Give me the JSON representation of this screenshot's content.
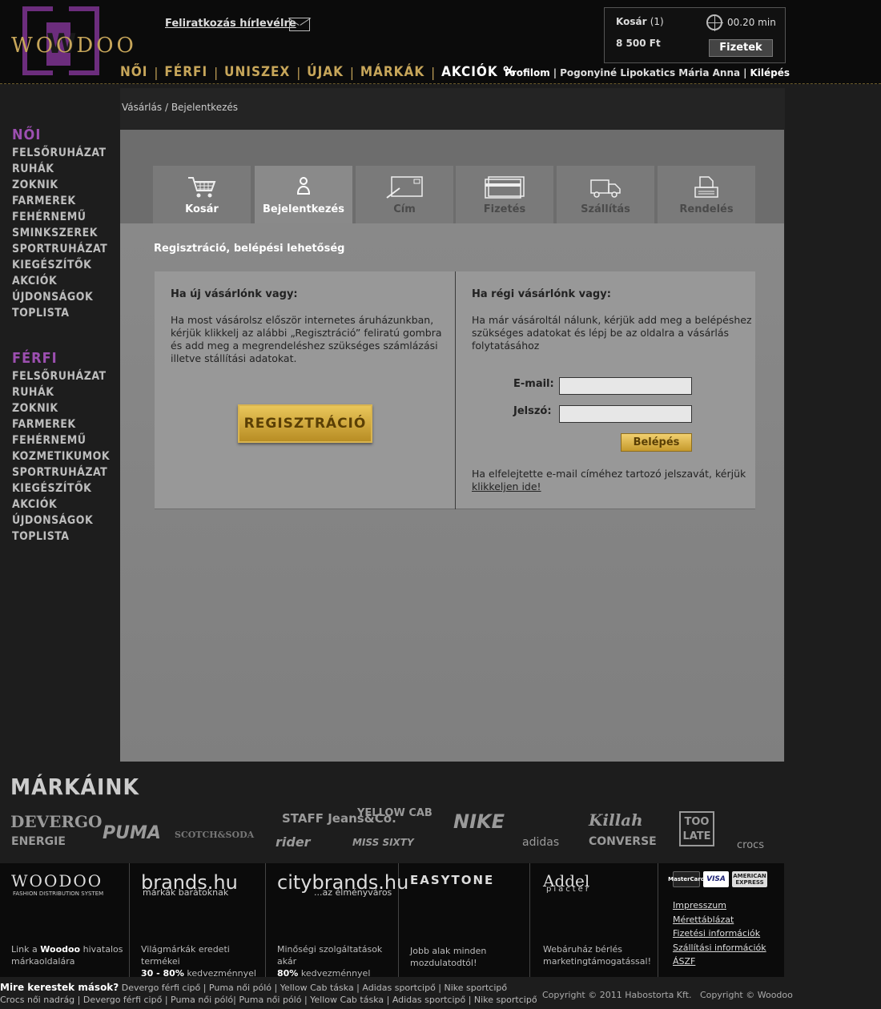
{
  "header": {
    "logo_text": "WOODOO",
    "logo_letter": "W",
    "newsletter_label": "Feliratkozás hírlevélre",
    "main_nav": [
      "NŐI",
      "FÉRFI",
      "UNISZEX",
      "ÚJAK",
      "MÁRKÁK",
      "AKCIÓK %"
    ],
    "user_nav": {
      "profile": "Profilom",
      "user_name": "Pogonyiné Lipokatics Mária Anna",
      "logout": "Kilépés"
    },
    "cart": {
      "label": "Kosár",
      "count": "(1)",
      "price": "8 500 Ft",
      "timer": "00.20 min",
      "pay_button": "Fizetek"
    }
  },
  "sidebar": {
    "women": {
      "title": "NŐI",
      "items": [
        "FELSŐRUHÁZAT",
        "RUHÁK",
        "ZOKNIK",
        "FARMEREK",
        "FEHÉRNEMŰ",
        "SMINKSZEREK",
        "SPORTRUHÁZAT",
        "KIEGÉSZÍTŐK",
        "AKCIÓK",
        "ÚJDONSÁGOK",
        "TOPLISTA"
      ]
    },
    "men": {
      "title": "FÉRFI",
      "items": [
        "FELSŐRUHÁZAT",
        "RUHÁK",
        "ZOKNIK",
        "FARMEREK",
        "FEHÉRNEMŰ",
        "KOZMETIKUMOK",
        "SPORTRUHÁZAT",
        "KIEGÉSZÍTŐK",
        "AKCIÓK",
        "ÚJDONSÁGOK",
        "TOPLISTA"
      ]
    }
  },
  "breadcrumb": {
    "parent": "Vásárlás",
    "separator": "/",
    "current": "Bejelentkezés"
  },
  "checkout_tabs": [
    {
      "label": "Kosár",
      "icon": "cart-icon"
    },
    {
      "label": "Bejelentkezés",
      "icon": "user-icon"
    },
    {
      "label": "Cím",
      "icon": "address-icon"
    },
    {
      "label": "Fizetés",
      "icon": "credit-card-icon"
    },
    {
      "label": "Szállítás",
      "icon": "truck-icon"
    },
    {
      "label": "Rendelés",
      "icon": "printer-icon"
    }
  ],
  "section_title": "Regisztráció, belépési lehetőség",
  "new_customer": {
    "title": "Ha új vásárlónk vagy:",
    "text_lines": [
      "Ha most vásárolsz először internetes áruházunkban,",
      "kérjük klikkelj az alábbi „Regisztráció” feliratú gombra",
      "és add meg a megrendeléshez szükséges számlázási",
      "illetve stállítási adatokat."
    ],
    "register_button": "REGISZTRÁCIÓ"
  },
  "returning_customer": {
    "title": "Ha régi vásárlónk vagy:",
    "text_lines": [
      "Ha már vásároltál nálunk, kérjük add meg a belépéshez",
      "szükséges adatokat és lépj be az oldalra a vásárlás",
      "folytatásához"
    ],
    "email_label": "E-mail:",
    "email_value": "",
    "password_label": "Jelszó:",
    "password_value": "",
    "login_button": "Belépés",
    "forgot_text": "Ha elfelejtette e-mail címéhez tartozó jelszavát, kérjük",
    "forgot_link": "klikkeljen ide!"
  },
  "brands": {
    "title": "MÁRKÁINK",
    "logos": [
      "DEVERGO",
      "ENERGIE",
      "PUMA",
      "SCOTCH&SODA",
      "STAFF Jeans&Co.",
      "rider",
      "YELLOW CAB",
      "MISS SIXTY",
      "NIKE",
      "adidas",
      "Killah",
      "CONVERSE",
      "TOO LATE",
      "crocs"
    ]
  },
  "footer": {
    "columns": [
      {
        "logo": "WOODOO",
        "sub": "FASHION DISTRIBUTION SYSTEM",
        "desc_pre": "Link a ",
        "desc_bold": "Woodoo",
        "desc_post": " hivatalos",
        "desc_line2": "márkaoldalára"
      },
      {
        "logo": "brands.hu",
        "sub": "márkák barátoknak",
        "desc_line1": "Világmárkák eredeti termékei",
        "desc_bold": "30 - 80%",
        "desc_post": " kedvezménnyel"
      },
      {
        "logo": "citybrands.hu",
        "sub": "...az élményváros",
        "desc_line1": "Minőségi szolgáltatások akár",
        "desc_bold": "80%",
        "desc_post": " kedvezménnyel"
      },
      {
        "logo": "EASYTONE",
        "desc_line1": "Jobb alak minden",
        "desc_line2": "mozdulatodtól!"
      },
      {
        "logo": "Addel",
        "sub": "piactér",
        "desc_line1": "Webáruház bérlés",
        "desc_line2": "marketingtámogatással!"
      }
    ],
    "cards": [
      "MasterCard",
      "VISA",
      "AMERICAN EXPRESS"
    ],
    "links": [
      "Impresszum",
      "Mérettáblázat",
      "Fizetési információk",
      "Szállítási információk",
      "ÁSZF"
    ]
  },
  "bottom": {
    "search_label": "Mire kerestek mások?",
    "search_line1": "Devergo férfi cipő | Puma női póló | Yellow Cab táska | Adidas sportcipő | Nike sportcipő",
    "search_line2": "Crocs női nadrág | Devergo férfi cipő | Puma női póló| Puma női póló | Yellow Cab táska | Adidas sportcipő | Nike sportcipő",
    "copyright": "Copyright © 2011 Habostorta Kft.   Copyright © Woodoo"
  },
  "colors": {
    "gold": "#c7a65a",
    "purple": "#9c4fb0",
    "logo_purple": "#6c2d7d"
  }
}
